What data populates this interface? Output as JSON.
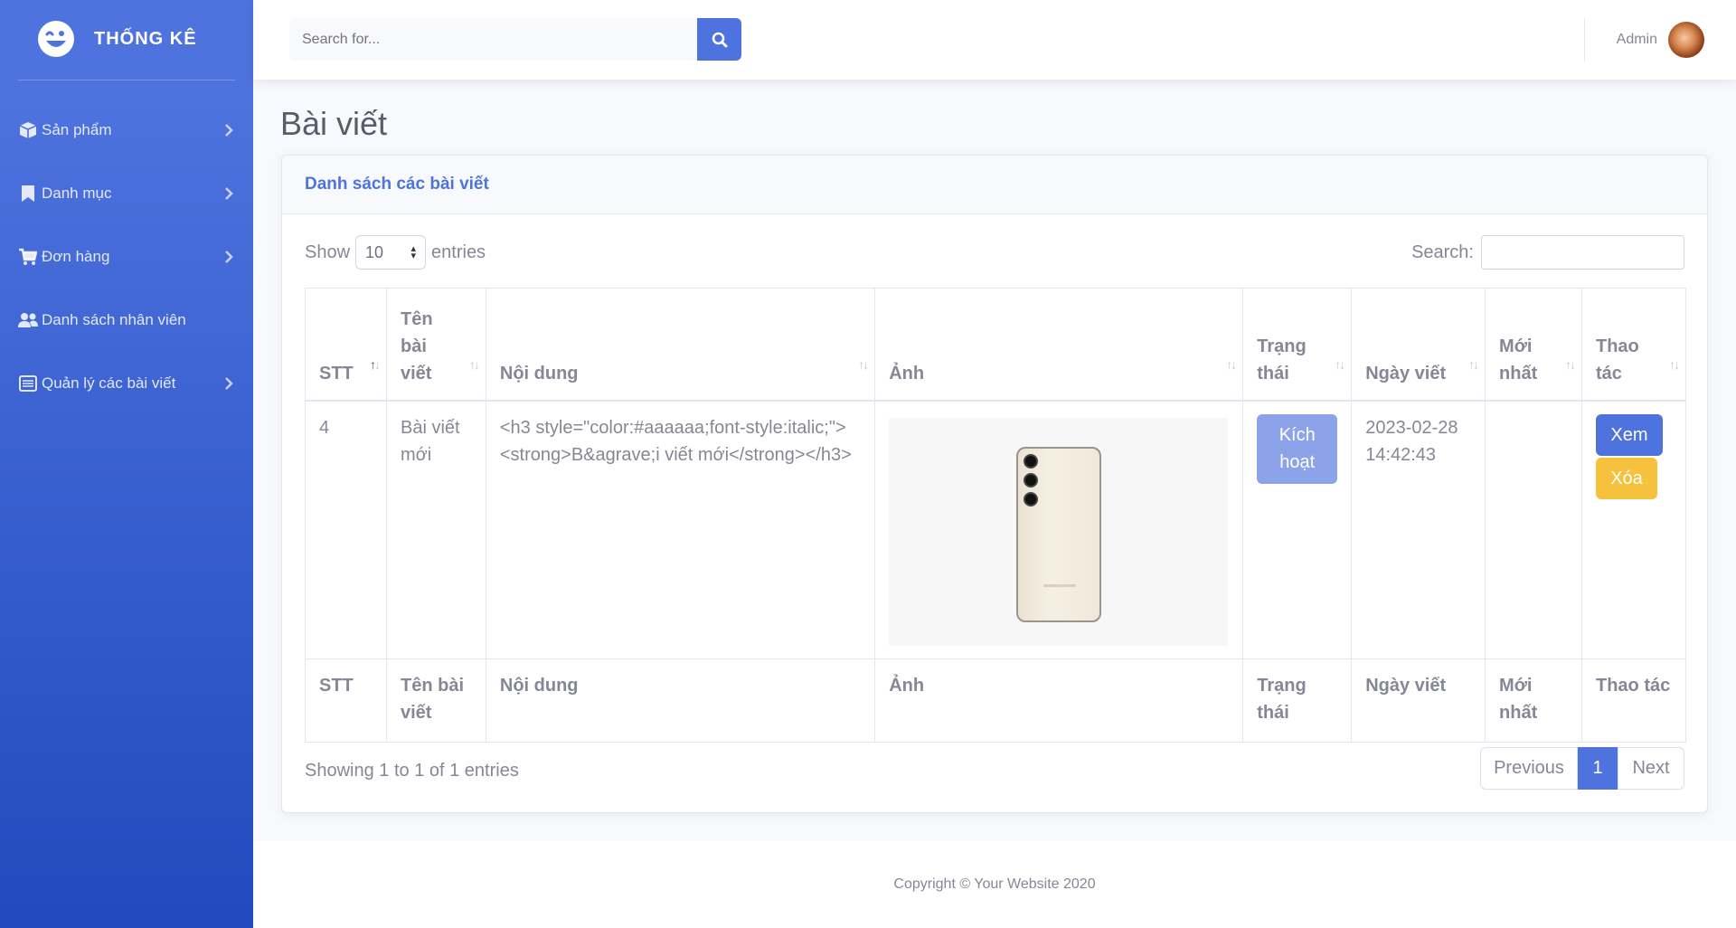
{
  "brand": {
    "name": "THỐNG KÊ",
    "logo_icon": "laugh-wink-icon"
  },
  "sidebar": {
    "items": [
      {
        "label": "Sản phẩm",
        "icon": "box-icon",
        "has_chevron": true
      },
      {
        "label": "Danh mục",
        "icon": "bookmark-icon",
        "has_chevron": true
      },
      {
        "label": "Đơn hàng",
        "icon": "cart-icon",
        "has_chevron": true
      },
      {
        "label": "Danh sách nhân viên",
        "icon": "users-icon",
        "has_chevron": false
      },
      {
        "label": "Quản lý các bài viết",
        "icon": "list-alt-icon",
        "has_chevron": true
      }
    ]
  },
  "topbar": {
    "search_placeholder": "Search for...",
    "search_icon": "search-icon",
    "user_name": "Admin"
  },
  "page": {
    "title": "Bài viết"
  },
  "card": {
    "title": "Danh sách các bài viết",
    "show_label": "Show",
    "entries_value": "10",
    "entries_label": "entries",
    "search_label": "Search:"
  },
  "table": {
    "headers": [
      "STT",
      "Tên bài viết",
      "Nội dung",
      "Ảnh",
      "Trạng thái",
      "Ngày viết",
      "Mới nhất",
      "Thao tác"
    ],
    "sorted_column": "STT",
    "rows": [
      {
        "stt": "4",
        "name": "Bài viết mới",
        "content": "<h3 style=\"color:#aaaaaa;font-style:italic;\"><strong>B&agrave;i viết mới</strong></h3>",
        "image": "phone-image",
        "status": "Kích hoạt",
        "date": "2023-02-28 14:42:43",
        "newest": "",
        "view_label": "Xem",
        "delete_label": "Xóa"
      }
    ],
    "footers": [
      "STT",
      "Tên bài viết",
      "Nội dung",
      "Ảnh",
      "Trạng thái",
      "Ngày viết",
      "Mới nhất",
      "Thao tác"
    ]
  },
  "table_info": "Showing 1 to 1 of 1 entries",
  "pagination": {
    "previous": "Previous",
    "current": "1",
    "next": "Next"
  },
  "footer": {
    "copyright": "Copyright © Your Website 2020"
  },
  "colors": {
    "primary": "#4e73df",
    "warning": "#f6c23e",
    "text": "#858796"
  }
}
